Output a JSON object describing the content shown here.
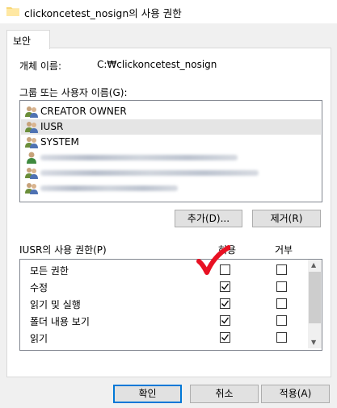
{
  "window": {
    "title": "clickoncetest_nosign의 사용 권한"
  },
  "tabs": [
    {
      "label": "보안"
    }
  ],
  "object": {
    "label": "개체 이름:",
    "value": "C:₩clickoncetest_nosign"
  },
  "groups": {
    "label": "그룹 또는 사용자 이름(G):",
    "items": [
      {
        "label": "CREATOR OWNER",
        "icon": "group-users-icon"
      },
      {
        "label": "IUSR",
        "icon": "group-users-icon",
        "selected": true
      },
      {
        "label": "SYSTEM",
        "icon": "group-users-icon"
      },
      {
        "label": "",
        "icon": "user-icon",
        "redacted": true
      },
      {
        "label": "",
        "icon": "group-users-icon",
        "redacted": true
      },
      {
        "label": "",
        "icon": "group-users-icon",
        "redacted": true
      }
    ]
  },
  "buttons": {
    "add": "추가(D)...",
    "remove": "제거(R)",
    "ok": "확인",
    "cancel": "취소",
    "apply": "적용(A)"
  },
  "permissions": {
    "label": "IUSR의 사용 권한(P)",
    "allow_header": "허용",
    "deny_header": "거부",
    "rows": [
      {
        "label": "모든 권한",
        "allow": false,
        "deny": false
      },
      {
        "label": "수정",
        "allow": true,
        "deny": false
      },
      {
        "label": "읽기 및 실행",
        "allow": true,
        "deny": false
      },
      {
        "label": "폴더 내용 보기",
        "allow": true,
        "deny": false
      },
      {
        "label": "읽기",
        "allow": true,
        "deny": false
      }
    ]
  },
  "annotation": {
    "type": "red-checkmark",
    "color": "#e81123"
  }
}
